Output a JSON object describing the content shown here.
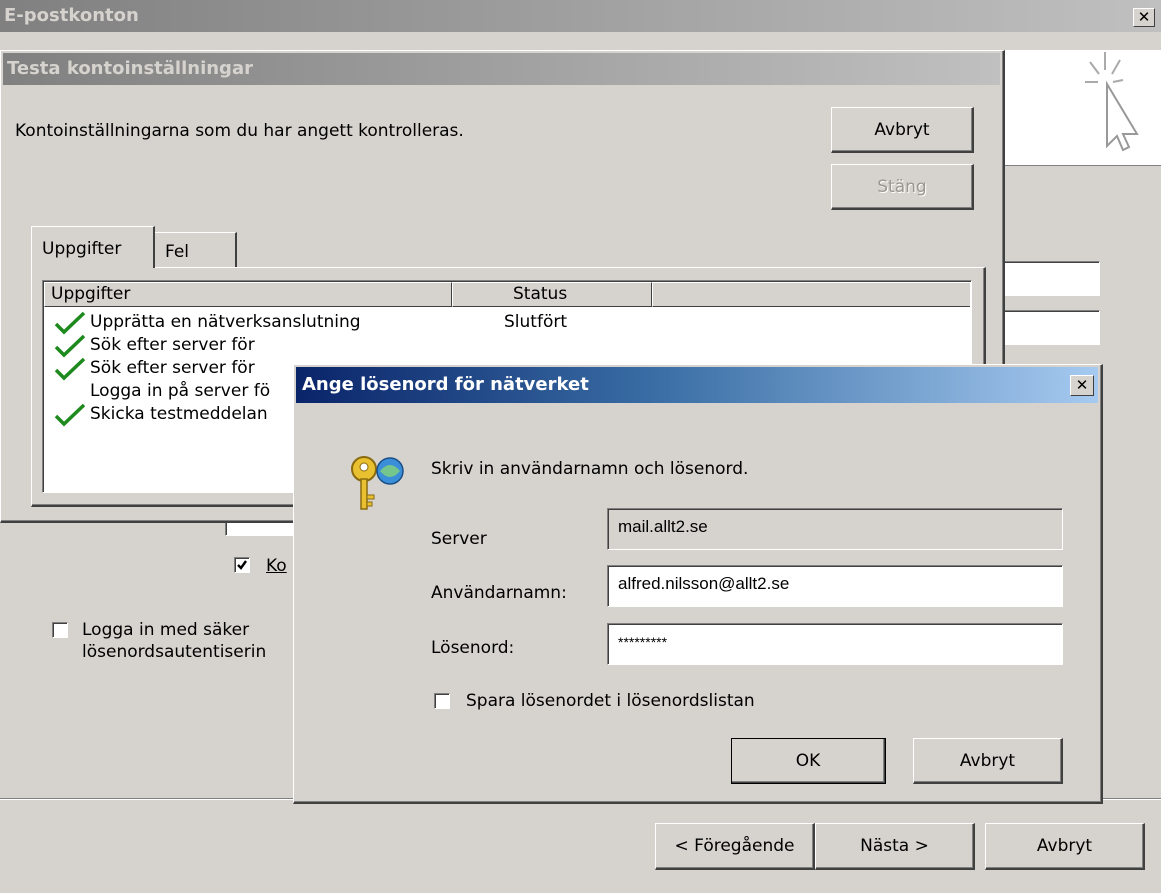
{
  "window": {
    "title": "E-postkonton",
    "close_glyph": "✕"
  },
  "test_dialog": {
    "title": "Testa kontoinställningar",
    "message": "Kontoinställningarna som du har angett kontrolleras.",
    "cancel_label": "Avbryt",
    "close_label": "Stäng",
    "tabs": [
      {
        "label": "Uppgifter"
      },
      {
        "label": "Fel"
      }
    ],
    "columns": {
      "task": "Uppgifter",
      "status": "Status"
    },
    "rows": [
      {
        "task": "Upprätta en nätverksanslutning",
        "status": "Slutfört",
        "done": true
      },
      {
        "task": "Sök efter server för",
        "status": "",
        "done": true
      },
      {
        "task": "Sök efter server för",
        "status": "",
        "done": true
      },
      {
        "task": "Logga in på server fö",
        "status": "",
        "done": false
      },
      {
        "task": "Skicka testmeddelan",
        "status": "",
        "done": true
      }
    ]
  },
  "background": {
    "checkbox_ko_label": "Ko",
    "spa_line1": "Logga in med säker",
    "spa_line1_accel": "o",
    "spa_line2": "lösenordsautentiserin"
  },
  "password_dialog": {
    "title": "Ange lösenord för nätverket",
    "prompt": "Skriv in användarnamn och lösenord.",
    "server_label": "Server",
    "server_value": "mail.allt2.se",
    "username_label": "Användarnamn:",
    "username_value": "alfred.nilsson@allt2.se",
    "password_label": "Lösenord:",
    "password_value": "*********",
    "save_label": "Spara lösenordet i lösenordslistan",
    "ok_label": "OK",
    "cancel_label": "Avbryt",
    "icon": "key-icon"
  },
  "wizard_buttons": {
    "back_label": "< Föregående",
    "next_label": "Nästa >",
    "cancel_label": "Avbryt"
  },
  "colors": {
    "face": "#d6d3ce",
    "inactive_title_start": "#808080",
    "inactive_title_end": "#c0c0c0",
    "active_title_start": "#0a246a",
    "active_title_end": "#a6caf0",
    "checkmark": "#1e8a1e"
  }
}
